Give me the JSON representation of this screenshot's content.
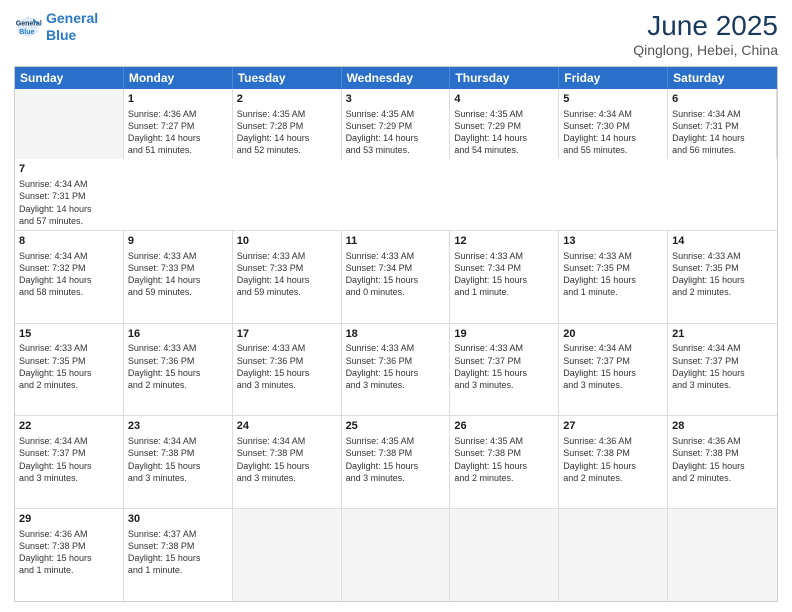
{
  "header": {
    "logo_line1": "General",
    "logo_line2": "Blue",
    "title": "June 2025",
    "subtitle": "Qinglong, Hebei, China"
  },
  "days": [
    "Sunday",
    "Monday",
    "Tuesday",
    "Wednesday",
    "Thursday",
    "Friday",
    "Saturday"
  ],
  "rows": [
    [
      {
        "num": "",
        "empty": true
      },
      {
        "num": "1",
        "sunrise": "4:36 AM",
        "sunset": "7:27 PM",
        "daylight": "14 hours and 51 minutes."
      },
      {
        "num": "2",
        "sunrise": "4:35 AM",
        "sunset": "7:28 PM",
        "daylight": "14 hours and 52 minutes."
      },
      {
        "num": "3",
        "sunrise": "4:35 AM",
        "sunset": "7:29 PM",
        "daylight": "14 hours and 53 minutes."
      },
      {
        "num": "4",
        "sunrise": "4:35 AM",
        "sunset": "7:29 PM",
        "daylight": "14 hours and 54 minutes."
      },
      {
        "num": "5",
        "sunrise": "4:34 AM",
        "sunset": "7:30 PM",
        "daylight": "14 hours and 55 minutes."
      },
      {
        "num": "6",
        "sunrise": "4:34 AM",
        "sunset": "7:31 PM",
        "daylight": "14 hours and 56 minutes."
      },
      {
        "num": "7",
        "sunrise": "4:34 AM",
        "sunset": "7:31 PM",
        "daylight": "14 hours and 57 minutes."
      }
    ],
    [
      {
        "num": "8",
        "sunrise": "4:34 AM",
        "sunset": "7:32 PM",
        "daylight": "14 hours and 58 minutes."
      },
      {
        "num": "9",
        "sunrise": "4:33 AM",
        "sunset": "7:33 PM",
        "daylight": "14 hours and 59 minutes."
      },
      {
        "num": "10",
        "sunrise": "4:33 AM",
        "sunset": "7:33 PM",
        "daylight": "14 hours and 59 minutes."
      },
      {
        "num": "11",
        "sunrise": "4:33 AM",
        "sunset": "7:34 PM",
        "daylight": "15 hours and 0 minutes."
      },
      {
        "num": "12",
        "sunrise": "4:33 AM",
        "sunset": "7:34 PM",
        "daylight": "15 hours and 1 minute."
      },
      {
        "num": "13",
        "sunrise": "4:33 AM",
        "sunset": "7:35 PM",
        "daylight": "15 hours and 1 minute."
      },
      {
        "num": "14",
        "sunrise": "4:33 AM",
        "sunset": "7:35 PM",
        "daylight": "15 hours and 2 minutes."
      }
    ],
    [
      {
        "num": "15",
        "sunrise": "4:33 AM",
        "sunset": "7:35 PM",
        "daylight": "15 hours and 2 minutes."
      },
      {
        "num": "16",
        "sunrise": "4:33 AM",
        "sunset": "7:36 PM",
        "daylight": "15 hours and 2 minutes."
      },
      {
        "num": "17",
        "sunrise": "4:33 AM",
        "sunset": "7:36 PM",
        "daylight": "15 hours and 3 minutes."
      },
      {
        "num": "18",
        "sunrise": "4:33 AM",
        "sunset": "7:36 PM",
        "daylight": "15 hours and 3 minutes."
      },
      {
        "num": "19",
        "sunrise": "4:33 AM",
        "sunset": "7:37 PM",
        "daylight": "15 hours and 3 minutes."
      },
      {
        "num": "20",
        "sunrise": "4:34 AM",
        "sunset": "7:37 PM",
        "daylight": "15 hours and 3 minutes."
      },
      {
        "num": "21",
        "sunrise": "4:34 AM",
        "sunset": "7:37 PM",
        "daylight": "15 hours and 3 minutes."
      }
    ],
    [
      {
        "num": "22",
        "sunrise": "4:34 AM",
        "sunset": "7:37 PM",
        "daylight": "15 hours and 3 minutes."
      },
      {
        "num": "23",
        "sunrise": "4:34 AM",
        "sunset": "7:38 PM",
        "daylight": "15 hours and 3 minutes."
      },
      {
        "num": "24",
        "sunrise": "4:34 AM",
        "sunset": "7:38 PM",
        "daylight": "15 hours and 3 minutes."
      },
      {
        "num": "25",
        "sunrise": "4:35 AM",
        "sunset": "7:38 PM",
        "daylight": "15 hours and 3 minutes."
      },
      {
        "num": "26",
        "sunrise": "4:35 AM",
        "sunset": "7:38 PM",
        "daylight": "15 hours and 2 minutes."
      },
      {
        "num": "27",
        "sunrise": "4:36 AM",
        "sunset": "7:38 PM",
        "daylight": "15 hours and 2 minutes."
      },
      {
        "num": "28",
        "sunrise": "4:36 AM",
        "sunset": "7:38 PM",
        "daylight": "15 hours and 2 minutes."
      }
    ],
    [
      {
        "num": "29",
        "sunrise": "4:36 AM",
        "sunset": "7:38 PM",
        "daylight": "15 hours and 1 minute."
      },
      {
        "num": "30",
        "sunrise": "4:37 AM",
        "sunset": "7:38 PM",
        "daylight": "15 hours and 1 minute."
      },
      {
        "num": "",
        "empty": true
      },
      {
        "num": "",
        "empty": true
      },
      {
        "num": "",
        "empty": true
      },
      {
        "num": "",
        "empty": true
      },
      {
        "num": "",
        "empty": true
      }
    ]
  ]
}
